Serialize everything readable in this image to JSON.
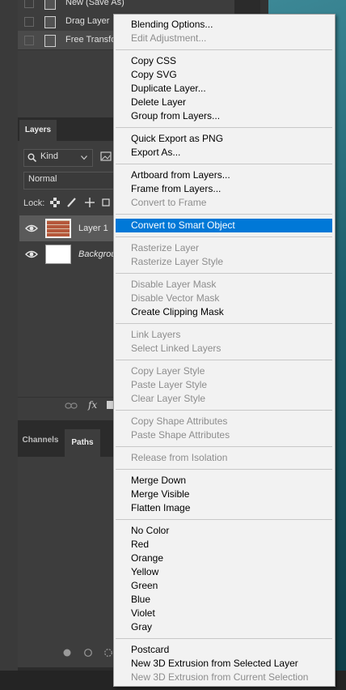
{
  "history": {
    "items": [
      {
        "label": "New (Save As)",
        "selected": false
      },
      {
        "label": "Drag Layer",
        "selected": false
      },
      {
        "label": "Free Transform",
        "selected": true
      }
    ]
  },
  "layers_panel": {
    "tab": "Layers",
    "kind_filter": "Kind",
    "blend_mode": "Normal",
    "lock_label": "Lock:",
    "layers": [
      {
        "name": "Layer 1",
        "selected": true,
        "thumb": "brick-texture"
      },
      {
        "name": "Background",
        "selected": false,
        "thumb": "white"
      }
    ]
  },
  "paths_panel": {
    "tabs": [
      "Channels",
      "Paths"
    ],
    "active_tab": "Paths"
  },
  "context_menu": {
    "groups": [
      [
        {
          "label": "Blending Options...",
          "enabled": true
        },
        {
          "label": "Edit Adjustment...",
          "enabled": false
        }
      ],
      [
        {
          "label": "Copy CSS",
          "enabled": true
        },
        {
          "label": "Copy SVG",
          "enabled": true
        },
        {
          "label": "Duplicate Layer...",
          "enabled": true
        },
        {
          "label": "Delete Layer",
          "enabled": true
        },
        {
          "label": "Group from Layers...",
          "enabled": true
        }
      ],
      [
        {
          "label": "Quick Export as PNG",
          "enabled": true
        },
        {
          "label": "Export As...",
          "enabled": true
        }
      ],
      [
        {
          "label": "Artboard from Layers...",
          "enabled": true
        },
        {
          "label": "Frame from Layers...",
          "enabled": true
        },
        {
          "label": "Convert to Frame",
          "enabled": false
        }
      ],
      [
        {
          "label": "Convert to Smart Object",
          "enabled": true,
          "highlighted": true
        }
      ],
      [
        {
          "label": "Rasterize Layer",
          "enabled": false
        },
        {
          "label": "Rasterize Layer Style",
          "enabled": false
        }
      ],
      [
        {
          "label": "Disable Layer Mask",
          "enabled": false
        },
        {
          "label": "Disable Vector Mask",
          "enabled": false
        },
        {
          "label": "Create Clipping Mask",
          "enabled": true
        }
      ],
      [
        {
          "label": "Link Layers",
          "enabled": false
        },
        {
          "label": "Select Linked Layers",
          "enabled": false
        }
      ],
      [
        {
          "label": "Copy Layer Style",
          "enabled": false
        },
        {
          "label": "Paste Layer Style",
          "enabled": false
        },
        {
          "label": "Clear Layer Style",
          "enabled": false
        }
      ],
      [
        {
          "label": "Copy Shape Attributes",
          "enabled": false
        },
        {
          "label": "Paste Shape Attributes",
          "enabled": false
        }
      ],
      [
        {
          "label": "Release from Isolation",
          "enabled": false
        }
      ],
      [
        {
          "label": "Merge Down",
          "enabled": true
        },
        {
          "label": "Merge Visible",
          "enabled": true
        },
        {
          "label": "Flatten Image",
          "enabled": true
        }
      ],
      [
        {
          "label": "No Color",
          "enabled": true
        },
        {
          "label": "Red",
          "enabled": true
        },
        {
          "label": "Orange",
          "enabled": true
        },
        {
          "label": "Yellow",
          "enabled": true
        },
        {
          "label": "Green",
          "enabled": true
        },
        {
          "label": "Blue",
          "enabled": true
        },
        {
          "label": "Violet",
          "enabled": true
        },
        {
          "label": "Gray",
          "enabled": true
        }
      ],
      [
        {
          "label": "Postcard",
          "enabled": true
        },
        {
          "label": "New 3D Extrusion from Selected Layer",
          "enabled": true
        },
        {
          "label": "New 3D Extrusion from Current Selection",
          "enabled": false
        }
      ]
    ]
  },
  "colors": {
    "menu_highlight": "#0078d7",
    "menu_bg": "#f2f2f2",
    "panel_bg": "#3d3d3d"
  }
}
